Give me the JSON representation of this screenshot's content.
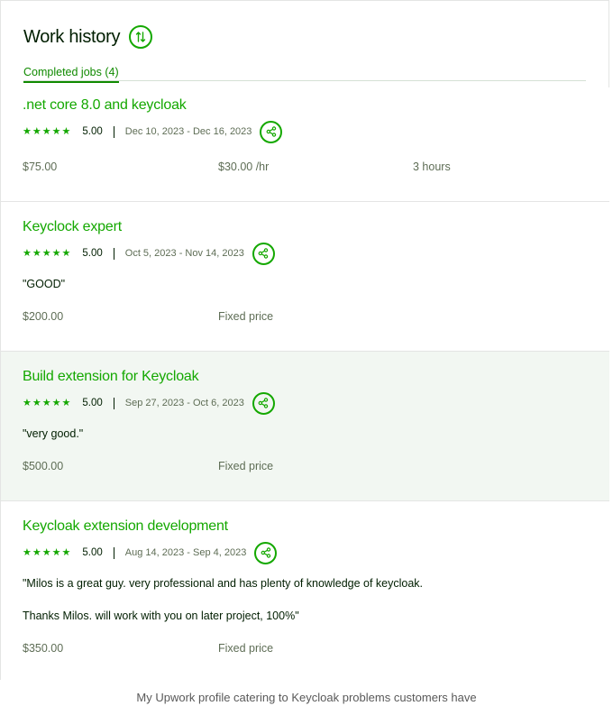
{
  "header": {
    "title": "Work history"
  },
  "tabs": {
    "completed_label": "Completed jobs (4)"
  },
  "jobs": [
    {
      "title": ".net core 8.0 and keycloak",
      "stars": 5,
      "score": "5.00",
      "dates": "Dec 10, 2023 - Dec 16, 2023",
      "amount": "$75.00",
      "rate": "$30.00 /hr",
      "hours": "3 hours"
    },
    {
      "title": "Keyclock expert",
      "stars": 5,
      "score": "5.00",
      "dates": "Oct 5, 2023 - Nov 14, 2023",
      "feedback": "\"GOOD\"",
      "amount": "$200.00",
      "type": "Fixed price"
    },
    {
      "title": "Build extension for Keycloak",
      "stars": 5,
      "score": "5.00",
      "dates": "Sep 27, 2023 - Oct 6, 2023",
      "feedback": "\"very good.\"",
      "amount": "$500.00",
      "type": "Fixed price"
    },
    {
      "title": "Keycloak extension development",
      "stars": 5,
      "score": "5.00",
      "dates": "Aug 14, 2023 - Sep 4, 2023",
      "feedback_line1": "\"Milos is a great guy. very professional and has plenty of knowledge of keycloak.",
      "feedback_line2": "Thanks Milos. will work with you on later project, 100%\"",
      "amount": "$350.00",
      "type": "Fixed price"
    }
  ],
  "caption": "My Upwork profile catering to Keycloak problems customers have",
  "icons": {
    "sort": "sort-icon",
    "share": "share-icon",
    "star": "star-icon"
  },
  "colors": {
    "accent": "#14a800",
    "highlight_bg": "#f2f7f2"
  }
}
